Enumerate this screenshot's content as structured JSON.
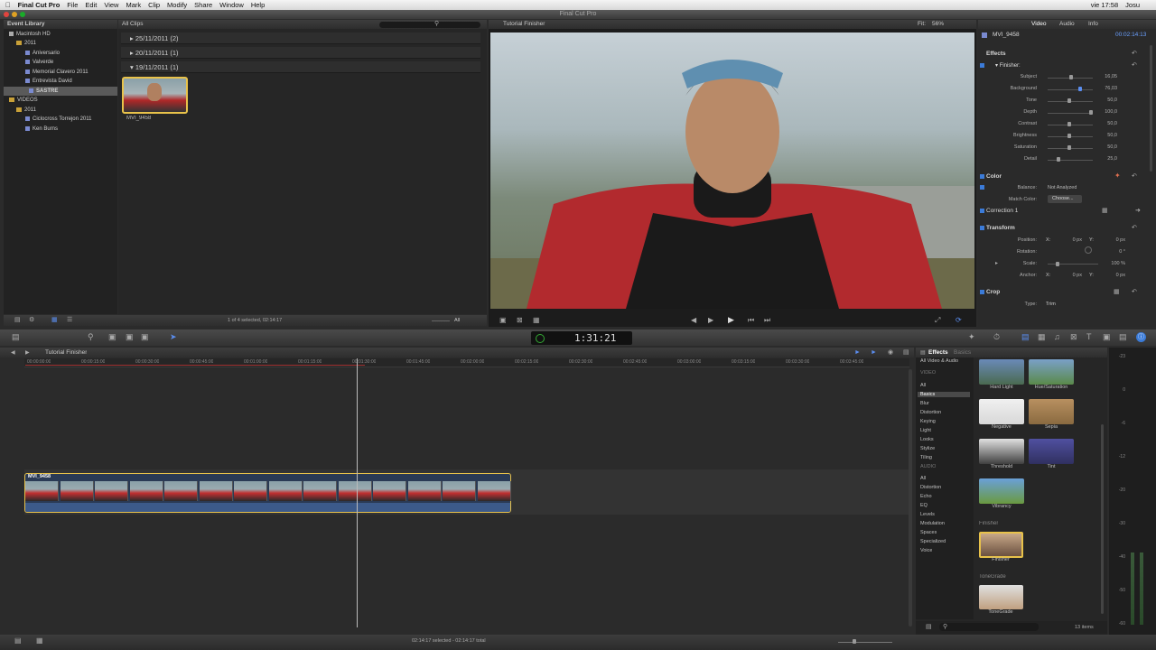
{
  "menubar": {
    "app": "Final Cut Pro",
    "items": [
      "File",
      "Edit",
      "View",
      "Mark",
      "Clip",
      "Modify",
      "Share",
      "Window",
      "Help"
    ],
    "status": {
      "time": "vie 17:58",
      "user": "Josu"
    }
  },
  "window": {
    "title": "Final Cut Pro"
  },
  "library": {
    "header": "Event Library",
    "items": [
      {
        "label": "Macintosh HD",
        "kind": "drive"
      },
      {
        "label": "2011",
        "kind": "folder"
      },
      {
        "label": "Aniversario",
        "kind": "event"
      },
      {
        "label": "Valverde",
        "kind": "event"
      },
      {
        "label": "Memorial Clavero 2011",
        "kind": "event"
      },
      {
        "label": "Entrevista David",
        "kind": "event"
      },
      {
        "label": "SASTRE",
        "kind": "event",
        "selected": true
      },
      {
        "label": "VIDEOS",
        "kind": "drive"
      },
      {
        "label": "2011",
        "kind": "folder"
      },
      {
        "label": "Ciclocross Torrejon 2011",
        "kind": "event"
      },
      {
        "label": "Ken Burns",
        "kind": "event"
      }
    ]
  },
  "browser": {
    "header": "All Clips",
    "dates": [
      "25/11/2011  (2)",
      "20/11/2011  (1)",
      "19/11/2011  (1)"
    ],
    "clip_name": "MVI_9458",
    "status": "1 of 4 selected, 02:14:17",
    "filter": "All"
  },
  "viewer": {
    "title": "Tutorial Finisher",
    "fit_label": "Fit:",
    "fit_value": "56%"
  },
  "inspector": {
    "tabs": [
      "Video",
      "Audio",
      "Info"
    ],
    "clip": "MVI_9458",
    "timecode": "00:02:14:13",
    "effects_title": "Effects",
    "finisher_title": "Finisher:",
    "params": [
      {
        "label": "Subject",
        "value": "16,05",
        "pos": 0.55
      },
      {
        "label": "Background",
        "value": "76,03",
        "pos": 0.76
      },
      {
        "label": "Tone",
        "value": "50,0",
        "pos": 0.5
      },
      {
        "label": "Depth",
        "value": "100,0",
        "pos": 1.0
      },
      {
        "label": "Contrast",
        "value": "50,0",
        "pos": 0.5
      },
      {
        "label": "Brightness",
        "value": "50,0",
        "pos": 0.5
      },
      {
        "label": "Saturation",
        "value": "50,0",
        "pos": 0.5
      },
      {
        "label": "Detail",
        "value": "25,0",
        "pos": 0.25
      }
    ],
    "color_title": "Color",
    "balance_label": "Balance:",
    "balance_value": "Not Analyzed",
    "match_label": "Match Color:",
    "match_button": "Choose...",
    "correction_title": "Correction 1",
    "transform_title": "Transform",
    "position_label": "Position:",
    "position_x": "0 px",
    "position_y": "0 px",
    "x_lbl": "X:",
    "y_lbl": "Y:",
    "rotation_label": "Rotation:",
    "rotation_value": "0 °",
    "scale_label": "Scale:",
    "scale_value": "100 %",
    "anchor_label": "Anchor:",
    "anchor_x": "0 px",
    "anchor_y": "0 px",
    "crop_title": "Crop",
    "type_label": "Type:",
    "type_value": "Trim"
  },
  "toolbar": {
    "timecode": "1:31:21"
  },
  "timeline": {
    "title": "Tutorial Finisher",
    "clip": "MVI_9458",
    "status": "02:14:17 selected - 02:14:17 total",
    "ticks": [
      "00:00:00:00",
      "00:00:15:00",
      "00:00:30:00",
      "00:00:45:00",
      "00:01:00:00",
      "00:01:15:00",
      "00:01:30:00",
      "00:01:45:00",
      "00:02:00:00",
      "00:02:15:00",
      "00:02:30:00",
      "00:02:45:00",
      "00:03:00:00",
      "00:03:15:00",
      "00:03:30:00",
      "00:03:45:00"
    ]
  },
  "effects_browser": {
    "title": "Effects",
    "tab": "Basics",
    "top": "All Video & Audio",
    "video_header": "VIDEO",
    "video_cats": [
      "All",
      "Basics",
      "Blur",
      "Distortion",
      "Keying",
      "Light",
      "Looks",
      "Stylize",
      "Tiling"
    ],
    "audio_header": "AUDIO",
    "audio_cats": [
      "All",
      "Distortion",
      "Echo",
      "EQ",
      "Levels",
      "Modulation",
      "Spaces",
      "Specialized",
      "Voice"
    ],
    "effects": [
      "Hard Light",
      "Hue/Saturation",
      "Negative",
      "Sepia",
      "Threshold",
      "Tint",
      "Vibrancy"
    ],
    "group1": "Finisher",
    "group1_items": [
      "Finisher"
    ],
    "group2": "ToneGrade",
    "group2_items": [
      "ToneGrade"
    ],
    "count": "13 items"
  },
  "meters": {
    "labels": [
      "-23",
      "0",
      "-6",
      "-12",
      "-20",
      "-30",
      "-40",
      "-50",
      "-60"
    ]
  }
}
